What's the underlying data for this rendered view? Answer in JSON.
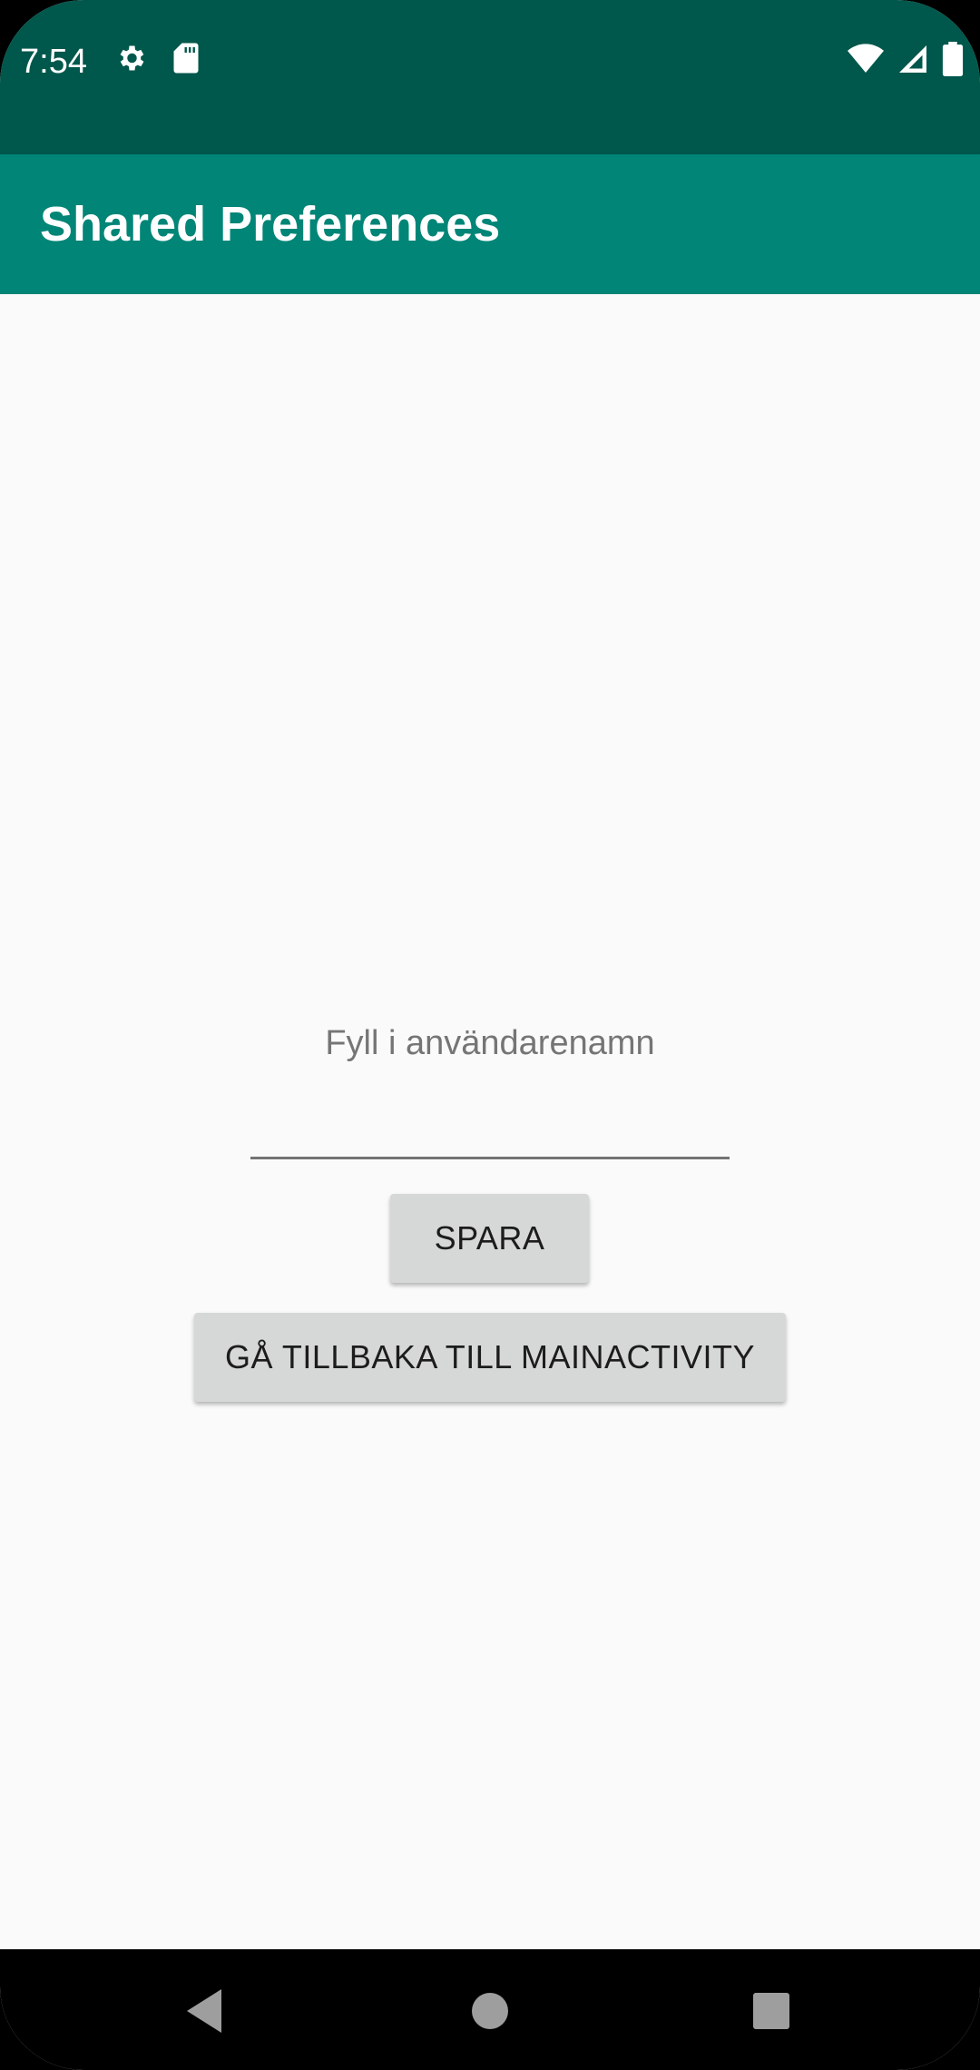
{
  "status_bar": {
    "time": "7:54",
    "left_icons": [
      "gear-icon",
      "sd-card-icon"
    ],
    "right_icons": [
      "wifi-icon",
      "cellular-signal-icon",
      "battery-icon"
    ],
    "background_color": "#00574b"
  },
  "app_bar": {
    "title": "Shared Preferences",
    "background_color": "#008577"
  },
  "main": {
    "label": "Fyll i användarenamn",
    "input_value": "",
    "save_button_label": "SPARA",
    "back_button_label": "GÅ TILLBAKA TILL MAINACTIVITY"
  },
  "nav_bar": {
    "buttons": [
      "back-icon",
      "home-icon",
      "recents-icon"
    ]
  }
}
